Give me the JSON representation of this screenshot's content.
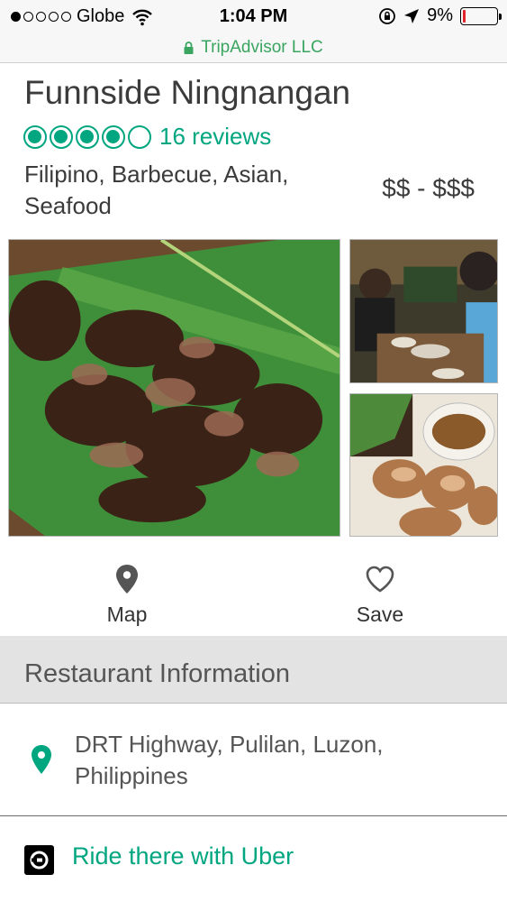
{
  "status_bar": {
    "carrier": "Globe",
    "signal_bars_filled": 1,
    "signal_bars_total": 5,
    "time": "1:04 PM",
    "battery_percent": "9%",
    "battery_level": 0.09,
    "battery_color": "#e0242a",
    "icons": [
      "wifi-icon",
      "rotation-lock-icon",
      "location-arrow-icon",
      "battery-icon"
    ]
  },
  "url_bar": {
    "site": "TripAdvisor LLC",
    "icon": "lock-icon",
    "color": "#3aa560"
  },
  "restaurant": {
    "name": "Funnside Ningnangan",
    "rating_filled": 4,
    "rating_total": 5,
    "reviews_label": "16 reviews",
    "cuisines": "Filipino, Barbecue, Asian, Seafood",
    "price_range": "$$ - $$$",
    "accent_color": "#00a680"
  },
  "photos": [
    {
      "name": "grilled-pork-on-banana-leaf"
    },
    {
      "name": "diners-at-table"
    },
    {
      "name": "roast-meat-with-dipping-sauce"
    }
  ],
  "actions": {
    "map": {
      "label": "Map",
      "icon": "map-pin-icon"
    },
    "save": {
      "label": "Save",
      "icon": "heart-icon"
    }
  },
  "info_section": {
    "title": "Restaurant Information",
    "address": "DRT Highway, Pulilan, Luzon, Philippines",
    "address_icon": "location-pin-icon",
    "uber_label": "Ride there with Uber",
    "uber_icon": "uber-icon"
  }
}
